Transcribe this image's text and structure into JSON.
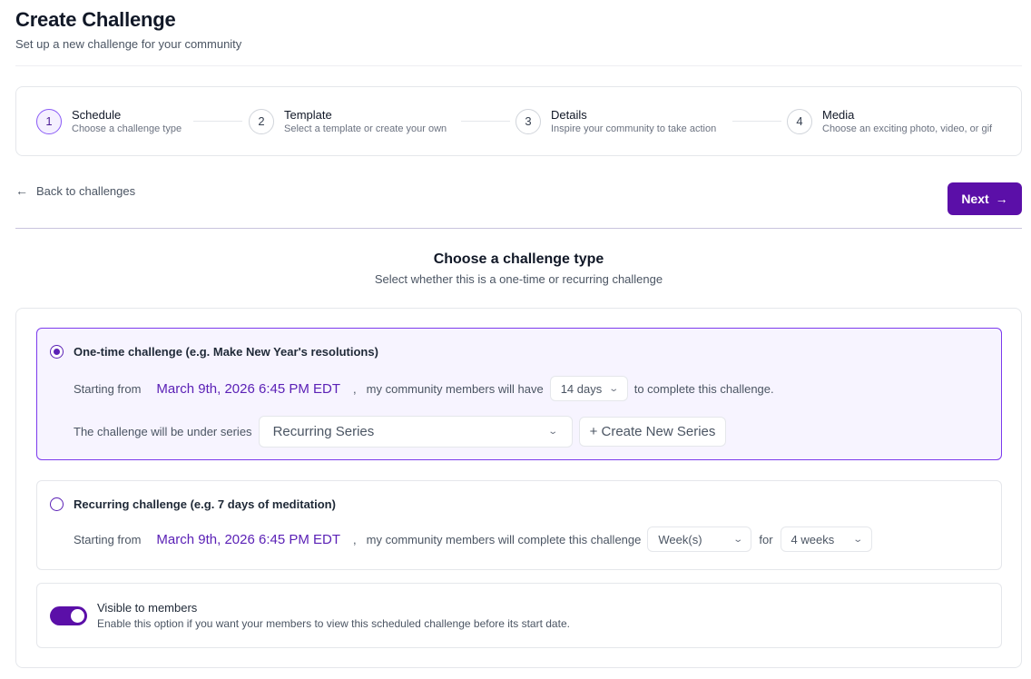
{
  "header": {
    "title": "Create Challenge",
    "subtitle": "Set up a new challenge for your community"
  },
  "stepper": {
    "steps": [
      {
        "number": "1",
        "title": "Schedule",
        "description": "Choose a challenge type"
      },
      {
        "number": "2",
        "title": "Template",
        "description": "Select a template or create your own"
      },
      {
        "number": "3",
        "title": "Details",
        "description": "Inspire your community to take action"
      },
      {
        "number": "4",
        "title": "Media",
        "description": "Choose an exciting photo, video, or gif"
      }
    ]
  },
  "nav": {
    "back_label": "Back to challenges",
    "next_label": "Next"
  },
  "section": {
    "title": "Choose a challenge type",
    "subtitle": "Select whether this is a one-time or recurring challenge"
  },
  "one_time": {
    "title": "One-time challenge (e.g. Make New Year's resolutions)",
    "starting_label": "Starting from",
    "date": "March 9th, 2026 6:45 PM EDT",
    "comma": ",",
    "members_text": "my community members will have",
    "duration": "14 days",
    "complete_text": "to complete this challenge.",
    "series_label": "The challenge will be under series",
    "series_value": "Recurring Series",
    "create_series_label": "+ Create New Series"
  },
  "recurring": {
    "title": "Recurring challenge (e.g. 7 days of meditation)",
    "starting_label": "Starting from",
    "date": "March 9th, 2026 6:45 PM EDT",
    "comma": ",",
    "members_text": "my community members will complete this challenge",
    "frequency": "Week(s)",
    "for_label": "for",
    "length": "4 weeks"
  },
  "visibility": {
    "title": "Visible to members",
    "description": "Enable this option if you want your members to view this scheduled challenge before its start date.",
    "enabled": true
  },
  "colors": {
    "accent": "#5b0fa8",
    "link": "#5b21b6",
    "selected_bg": "#f7f4ff"
  }
}
